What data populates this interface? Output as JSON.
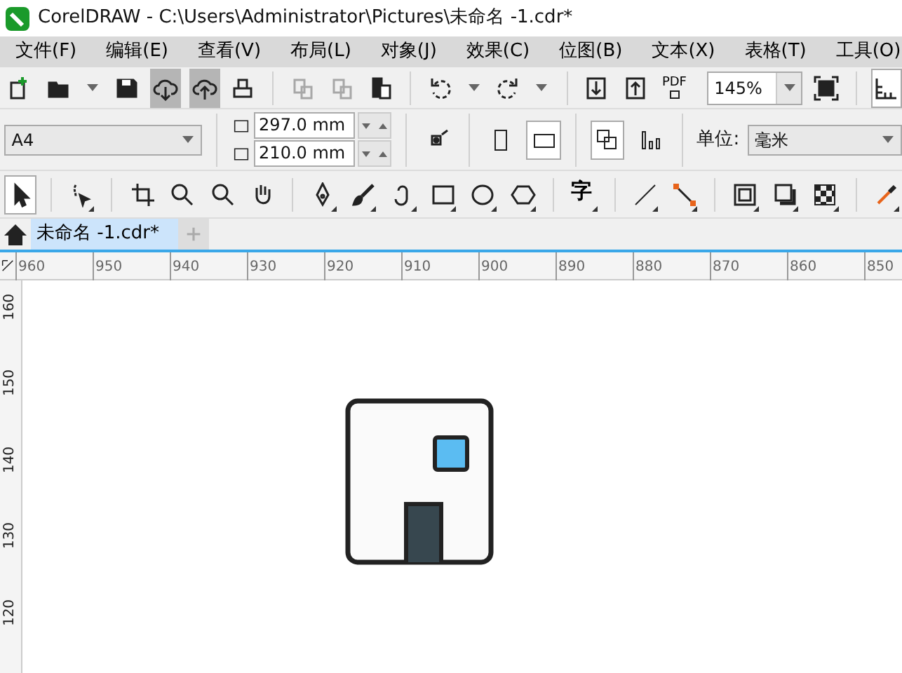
{
  "window": {
    "title": "CorelDRAW - C:\\Users\\Administrator\\Pictures\\未命名 -1.cdr*"
  },
  "menu": [
    "文件(F)",
    "编辑(E)",
    "查看(V)",
    "布局(L)",
    "对象(J)",
    "效果(C)",
    "位图(B)",
    "文本(X)",
    "表格(T)",
    "工具(O)"
  ],
  "standard_toolbar": {
    "buttons": [
      {
        "pressed": false,
        "disabled": false
      },
      {
        "pressed": false,
        "disabled": false
      },
      {
        "pressed": false,
        "disabled": false
      },
      {
        "pressed": true,
        "disabled": false
      },
      {
        "pressed": true,
        "disabled": false
      },
      {
        "pressed": false,
        "disabled": false
      },
      {
        "pressed": false,
        "disabled": true
      },
      {
        "pressed": false,
        "disabled": true
      },
      {
        "pressed": false,
        "disabled": false
      },
      {
        "pressed": false,
        "disabled": false
      },
      {
        "pressed": false,
        "disabled": false
      },
      {
        "pressed": false,
        "disabled": false
      },
      {
        "pressed": false,
        "disabled": false
      }
    ],
    "pdf_label": "PDF",
    "zoom": "145%"
  },
  "property_bar": {
    "page_size": "A4",
    "width": "297.0 mm",
    "height": "210.0 mm",
    "units_label": "单位:",
    "units": "毫米"
  },
  "toolbox": {
    "tools": [
      {
        "selected": true
      },
      {
        "selected": false
      },
      {
        "selected": false
      },
      {
        "selected": false
      },
      {
        "selected": false
      },
      {
        "selected": false
      },
      {
        "selected": false
      },
      {
        "selected": false
      },
      {
        "selected": false
      },
      {
        "selected": false
      },
      {
        "selected": false
      },
      {
        "selected": false
      },
      {
        "selected": false
      },
      {
        "selected": false
      },
      {
        "selected": false
      },
      {
        "selected": false
      },
      {
        "selected": false
      },
      {
        "selected": false
      },
      {
        "selected": false
      }
    ],
    "text_tool_glyph": "字"
  },
  "document_tabs": [
    {
      "label": "未命名 -1.cdr*",
      "selected": true
    }
  ],
  "rulers": {
    "horizontal": [
      "960",
      "950",
      "940",
      "930",
      "920",
      "910",
      "900",
      "890",
      "880",
      "870",
      "860",
      "850"
    ],
    "vertical": [
      "160",
      "150",
      "140",
      "130",
      "120"
    ]
  }
}
